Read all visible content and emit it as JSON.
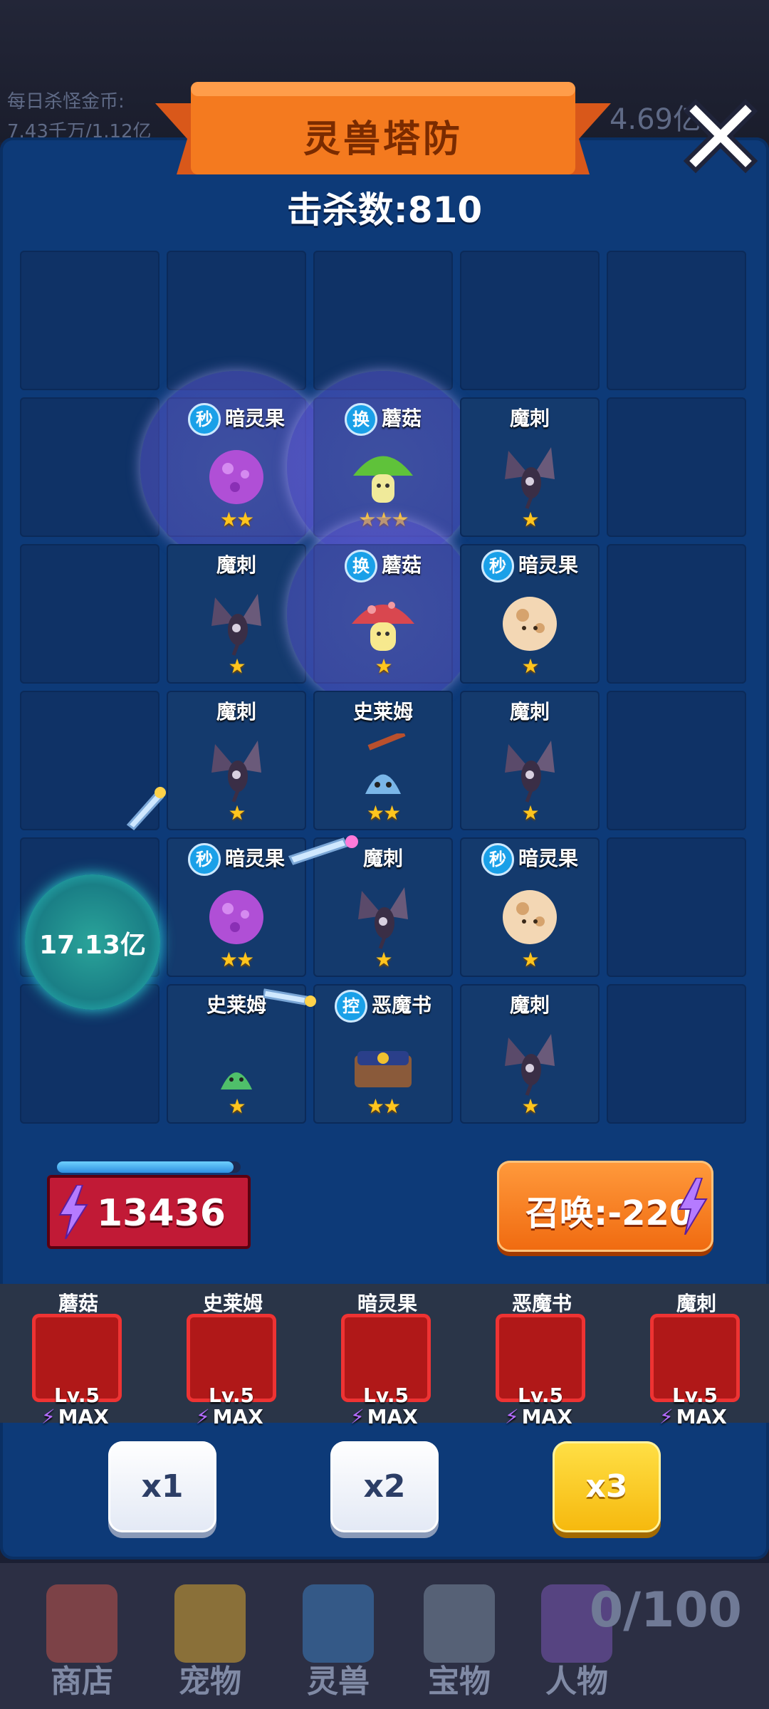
{
  "background": {
    "daily_label": "每日杀怪金币:",
    "daily_value": "7.43千万/1.12亿",
    "gold": "4.69亿"
  },
  "dialog": {
    "title": "灵兽塔防",
    "kills": "击杀数:810"
  },
  "grid": {
    "cells": [
      {
        "name": "暗灵果",
        "tag": "秒",
        "stars": "★★",
        "row": 1,
        "col": 1,
        "creature": "berry-purple",
        "aura": true
      },
      {
        "name": "蘑菇",
        "tag": "换",
        "stars": "★★★",
        "row": 1,
        "col": 2,
        "creature": "mushroom-green",
        "aura": true
      },
      {
        "name": "魔刺",
        "tag": "",
        "stars": "★",
        "row": 1,
        "col": 3,
        "creature": "spike"
      },
      {
        "name": "魔刺",
        "tag": "",
        "stars": "★",
        "row": 2,
        "col": 1,
        "creature": "spike"
      },
      {
        "name": "蘑菇",
        "tag": "换",
        "stars": "★",
        "row": 2,
        "col": 2,
        "creature": "mushroom-red",
        "aura": true
      },
      {
        "name": "暗灵果",
        "tag": "秒",
        "stars": "★",
        "row": 2,
        "col": 3,
        "creature": "berry-cream"
      },
      {
        "name": "魔刺",
        "tag": "",
        "stars": "★",
        "row": 3,
        "col": 1,
        "creature": "spike"
      },
      {
        "name": "史莱姆",
        "tag": "",
        "stars": "★★",
        "row": 3,
        "col": 2,
        "creature": "slime-blue"
      },
      {
        "name": "魔刺",
        "tag": "",
        "stars": "★",
        "row": 3,
        "col": 3,
        "creature": "spike"
      },
      {
        "name": "暗灵果",
        "tag": "秒",
        "stars": "★★",
        "row": 4,
        "col": 1,
        "creature": "berry-purple"
      },
      {
        "name": "魔刺",
        "tag": "",
        "stars": "★",
        "row": 4,
        "col": 2,
        "creature": "spike"
      },
      {
        "name": "暗灵果",
        "tag": "秒",
        "stars": "★",
        "row": 4,
        "col": 3,
        "creature": "berry-cream"
      },
      {
        "name": "史莱姆",
        "tag": "",
        "stars": "★",
        "row": 5,
        "col": 1,
        "creature": "slime-green"
      },
      {
        "name": "恶魔书",
        "tag": "控",
        "stars": "★★",
        "row": 5,
        "col": 2,
        "creature": "book"
      },
      {
        "name": "魔刺",
        "tag": "",
        "stars": "★",
        "row": 5,
        "col": 3,
        "creature": "spike"
      }
    ]
  },
  "enemy": {
    "hp": "17.13亿"
  },
  "energy": {
    "value": "13436",
    "fill_ratio": 0.96
  },
  "summon": {
    "label": "召唤:-220"
  },
  "roster": [
    {
      "name": "蘑菇",
      "level": "Lv.5",
      "max": "MAX"
    },
    {
      "name": "史莱姆",
      "level": "Lv.5",
      "max": "MAX"
    },
    {
      "name": "暗灵果",
      "level": "Lv.5",
      "max": "MAX"
    },
    {
      "name": "恶魔书",
      "level": "Lv.5",
      "max": "MAX"
    },
    {
      "name": "魔刺",
      "level": "Lv.5",
      "max": "MAX"
    }
  ],
  "speed": {
    "x1": "x1",
    "x2": "x2",
    "x3": "x3",
    "active": "x3"
  },
  "tabs": [
    {
      "label": "商店",
      "icon": "shop-icon"
    },
    {
      "label": "宠物",
      "icon": "pet-icon"
    },
    {
      "label": "灵兽",
      "icon": "spirit-beast-icon"
    },
    {
      "label": "宝物",
      "icon": "treasure-icon"
    },
    {
      "label": "人物",
      "icon": "character-icon"
    }
  ],
  "progress_count": "0/100",
  "colors": {
    "panel": "#0d3a78",
    "banner": "#f47a1f",
    "energy": "#c11a36",
    "summon": "#f27b22",
    "active_speed": "#f8c51a"
  }
}
